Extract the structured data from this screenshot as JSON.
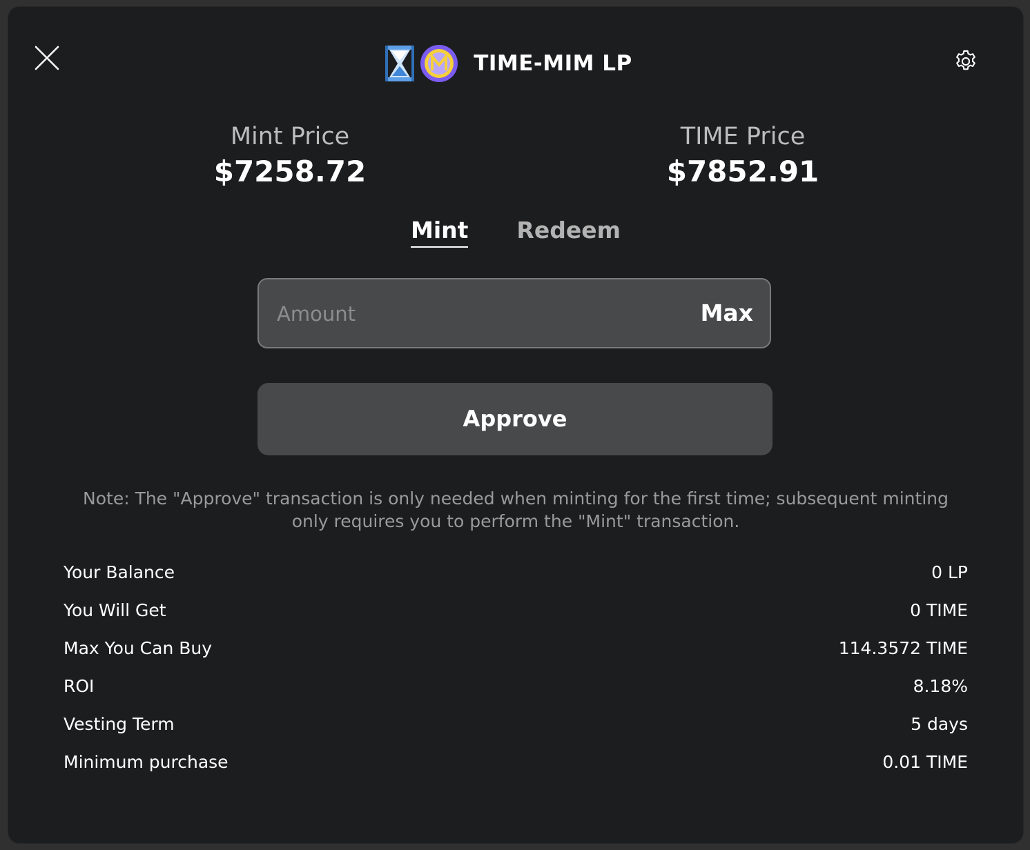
{
  "header": {
    "title": "TIME-MIM LP",
    "token_icons": [
      "hourglass-icon",
      "mim-token-icon"
    ]
  },
  "prices": {
    "mint": {
      "label": "Mint Price",
      "value": "$7258.72"
    },
    "time": {
      "label": "TIME Price",
      "value": "$7852.91"
    }
  },
  "tabs": [
    {
      "label": "Mint",
      "active": true
    },
    {
      "label": "Redeem",
      "active": false
    }
  ],
  "amount": {
    "placeholder": "Amount",
    "value": "",
    "max_label": "Max"
  },
  "approve_button": "Approve",
  "note": "Note: The \"Approve\" transaction is only needed when minting for the first time; subsequent minting only requires you to perform the \"Mint\" transaction.",
  "details": [
    {
      "label": "Your Balance",
      "value": "0 LP"
    },
    {
      "label": "You Will Get",
      "value": "0 TIME"
    },
    {
      "label": "Max You Can Buy",
      "value": "114.3572 TIME"
    },
    {
      "label": "ROI",
      "value": "8.18%"
    },
    {
      "label": "Vesting Term",
      "value": "5 days"
    },
    {
      "label": "Minimum purchase",
      "value": "0.01 TIME"
    }
  ],
  "colors": {
    "background": "#1c1d1f",
    "field": "#48494b",
    "text": "#ffffff",
    "muted": "#9a9a9a",
    "token_yellow": "#f5d03a",
    "token_purple": "#7b5cf0"
  }
}
